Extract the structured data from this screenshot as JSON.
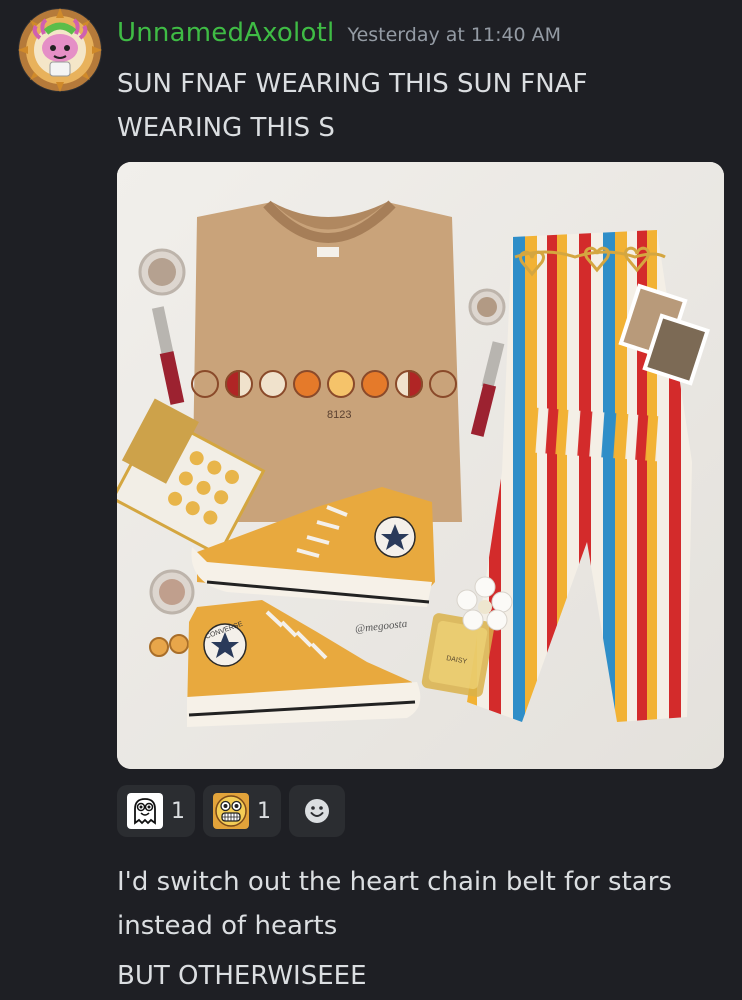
{
  "author": {
    "username": "UnnamedAxolotl",
    "timestamp": "Yesterday at 11:40 AM"
  },
  "messages": [
    "SUN FNAF WEARING THIS SUN FNAF WEARING THIS S",
    "I'd switch out the heart chain belt for stars instead of hearts",
    "BUT OTHERWISEEE"
  ],
  "attachment": {
    "shirt_print": "8123",
    "watermark": "@megoosta",
    "shoe_brand": "CONVERSE",
    "shoe_sub": "ALL STAR",
    "perfume_label": "DAISY"
  },
  "reactions": [
    {
      "emoji": "ghost-emoji",
      "count": "1"
    },
    {
      "emoji": "grin-emoji",
      "count": "1"
    }
  ],
  "colors": {
    "username": "#3fbc45",
    "background": "#1e1f24",
    "reaction_bg": "#2b2d31"
  }
}
